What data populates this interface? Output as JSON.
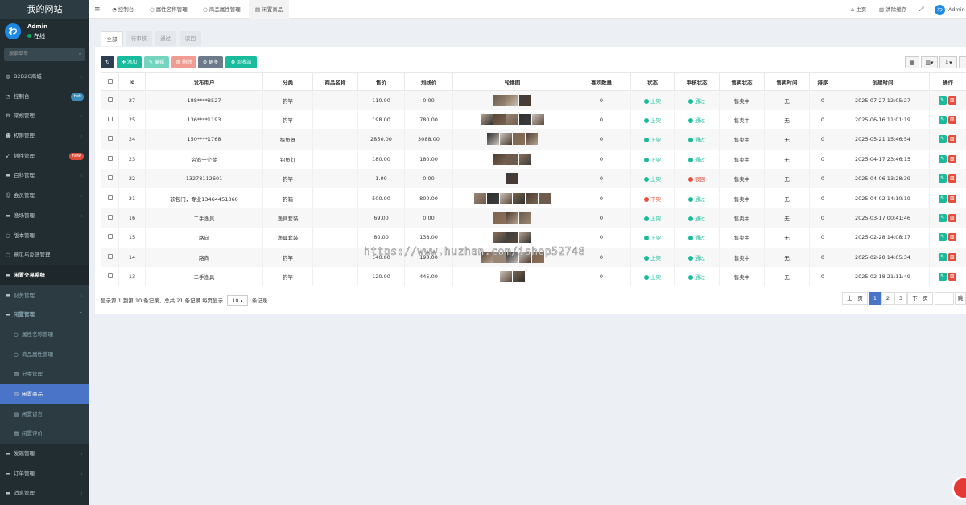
{
  "brand": "我的网站",
  "user": {
    "name": "Admin",
    "status": "在线",
    "avatar_letter": "わ"
  },
  "sidebar": {
    "search_placeholder": "搜索菜单",
    "items": [
      {
        "label": "B2B2C商城",
        "icon": "globe-icon",
        "arrow": "‹"
      },
      {
        "label": "控制台",
        "icon": "dashboard-icon",
        "badge": "hot",
        "badge_color": "#3c8dbc"
      },
      {
        "label": "常规管理",
        "icon": "cogs-icon",
        "arrow": "‹"
      },
      {
        "label": "权限管理",
        "icon": "group-icon",
        "arrow": "‹"
      },
      {
        "label": "插件管理",
        "icon": "rocket-icon",
        "badge": "new",
        "badge_color": "#dd4b39"
      },
      {
        "label": "百科管理",
        "icon": "folder-icon",
        "arrow": "‹"
      },
      {
        "label": "会员管理",
        "icon": "user-icon",
        "arrow": "‹"
      },
      {
        "label": "渔场管理",
        "icon": "folder-icon",
        "arrow": "‹"
      },
      {
        "label": "版本管理",
        "icon": "circle-icon"
      },
      {
        "label": "意见与反馈管理",
        "icon": "circle-icon"
      },
      {
        "label": "闲置交易系统",
        "icon": "folder-icon",
        "arrow": "⌄"
      },
      {
        "label": "财务管理",
        "icon": "folder-icon",
        "arrow": "‹"
      },
      {
        "label": "闲置管理",
        "icon": "folder-icon",
        "arrow": "⌄"
      },
      {
        "label": "属性名称管理",
        "icon": "circle-icon"
      },
      {
        "label": "商品属性管理",
        "icon": "circle-icon"
      },
      {
        "label": "分类管理",
        "icon": "list-icon"
      },
      {
        "label": "闲置商品",
        "icon": "list-icon"
      },
      {
        "label": "闲置留言",
        "icon": "list-icon"
      },
      {
        "label": "闲置评价",
        "icon": "list-icon"
      },
      {
        "label": "发现管理",
        "icon": "folder-icon",
        "arrow": "‹"
      },
      {
        "label": "订单管理",
        "icon": "folder-icon",
        "arrow": "‹"
      },
      {
        "label": "消息管理",
        "icon": "folder-icon",
        "arrow": "‹"
      }
    ]
  },
  "topbar": {
    "tabs": [
      "控制台",
      "属性名称管理",
      "商品属性管理",
      "闲置商品"
    ],
    "home": "主页",
    "clear_cache": "清除缓存",
    "admin": "Admin"
  },
  "filter_tabs": [
    "全部",
    "待审核",
    "通过",
    "驳回"
  ],
  "toolbar": {
    "add": "添加",
    "edit": "编辑",
    "delete": "删除",
    "more": "更多",
    "recycle": "回收站"
  },
  "table": {
    "headers": [
      "Id",
      "发布用户",
      "分类",
      "商品名称",
      "售价",
      "划线价",
      "轮播图",
      "喜欢数量",
      "状态",
      "审核状态",
      "售卖状态",
      "售卖时间",
      "排序",
      "创建时间",
      "操作"
    ],
    "rows": [
      {
        "id": "27",
        "user": "188****8527",
        "category": "钓竿",
        "name": "",
        "price": "110.00",
        "orig": "0.00",
        "imgs": 3,
        "likes": "0",
        "status": "上架",
        "audit": "通过",
        "sale": "售卖中",
        "sale_time": "无",
        "sort": "0",
        "created": "2025-07-27 12:05:27"
      },
      {
        "id": "25",
        "user": "136****1193",
        "category": "钓竿",
        "name": "",
        "price": "198.00",
        "orig": "780.00",
        "imgs": 5,
        "likes": "0",
        "status": "上架",
        "audit": "通过",
        "sale": "售卖中",
        "sale_time": "无",
        "sort": "0",
        "created": "2025-06-16 11:01:19"
      },
      {
        "id": "24",
        "user": "150****1768",
        "category": "探鱼器",
        "name": "",
        "price": "2850.00",
        "orig": "3088.00",
        "imgs": 4,
        "likes": "0",
        "status": "上架",
        "audit": "通过",
        "sale": "售卖中",
        "sale_time": "无",
        "sort": "0",
        "created": "2025-05-21 15:46:54"
      },
      {
        "id": "23",
        "user": "穷追一个梦",
        "category": "钓鱼灯",
        "name": "",
        "price": "180.00",
        "orig": "180.00",
        "imgs": 3,
        "likes": "0",
        "status": "上架",
        "audit": "通过",
        "sale": "售卖中",
        "sale_time": "无",
        "sort": "0",
        "created": "2025-04-17 23:46:15"
      },
      {
        "id": "22",
        "user": "13278112601",
        "category": "钓竿",
        "name": "",
        "price": "1.00",
        "orig": "0.00",
        "imgs": 1,
        "likes": "0",
        "status": "上架",
        "audit": "驳回",
        "sale": "售卖中",
        "sale_time": "无",
        "sort": "0",
        "created": "2025-04-06 13:28:39"
      },
      {
        "id": "21",
        "user": "软包门，专业13464451360",
        "category": "钓箱",
        "name": "",
        "price": "500.00",
        "orig": "800.00",
        "imgs": 6,
        "likes": "0",
        "status": "下架",
        "audit": "通过",
        "sale": "售卖中",
        "sale_time": "无",
        "sort": "0",
        "created": "2025-04-02 14:10:19"
      },
      {
        "id": "16",
        "user": "二手渔具",
        "category": "渔具套装",
        "name": "",
        "price": "69.00",
        "orig": "0.00",
        "imgs": 3,
        "likes": "0",
        "status": "上架",
        "audit": "通过",
        "sale": "售卖中",
        "sale_time": "无",
        "sort": "0",
        "created": "2025-03-17 00:41:46"
      },
      {
        "id": "15",
        "user": "路向",
        "category": "渔具套装",
        "name": "",
        "price": "80.00",
        "orig": "138.00",
        "imgs": 3,
        "likes": "0",
        "status": "上架",
        "audit": "通过",
        "sale": "售卖中",
        "sale_time": "无",
        "sort": "0",
        "created": "2025-02-28 14:08:17"
      },
      {
        "id": "14",
        "user": "路向",
        "category": "钓竿",
        "name": "",
        "price": "140.00",
        "orig": "198.00",
        "imgs": 5,
        "likes": "0",
        "status": "上架",
        "audit": "通过",
        "sale": "售卖中",
        "sale_time": "无",
        "sort": "0",
        "created": "2025-02-28 14:05:34"
      },
      {
        "id": "13",
        "user": "二手渔具",
        "category": "钓竿",
        "name": "",
        "price": "120.00",
        "orig": "445.00",
        "imgs": 2,
        "likes": "0",
        "status": "上架",
        "audit": "通过",
        "sale": "售卖中",
        "sale_time": "无",
        "sort": "0",
        "created": "2025-02-18 21:11:49"
      }
    ]
  },
  "footer": {
    "summary_pre": "显示第 1 到第 10 条记录，总共 21 条记录 每页显示",
    "page_size": "10",
    "summary_post": "条记录"
  },
  "pagination": {
    "prev": "上一页",
    "pages": [
      "1",
      "2",
      "3"
    ],
    "next": "下一页",
    "jump": "跳"
  },
  "watermark": "https://www.huzhan.com/ishop52748",
  "colors": {
    "sidebar": "#222d32",
    "active": "#4974c7",
    "success": "#18bc9c",
    "danger": "#e74c3c",
    "warning": "#f39c12"
  }
}
